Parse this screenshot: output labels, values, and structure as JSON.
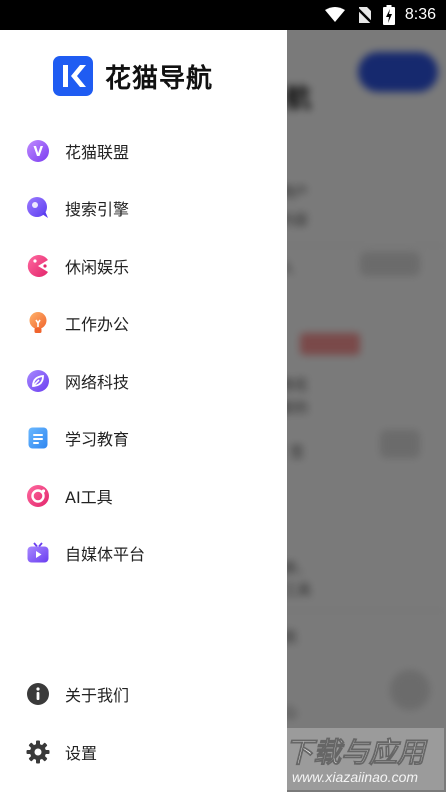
{
  "status_bar": {
    "time": "8:36"
  },
  "app": {
    "name": "花猫导航"
  },
  "menu": [
    {
      "label": "花猫联盟",
      "icon": "v-badge-icon"
    },
    {
      "label": "搜索引擎",
      "icon": "search-bubble-icon"
    },
    {
      "label": "休闲娱乐",
      "icon": "pacman-icon"
    },
    {
      "label": "工作办公",
      "icon": "lightbulb-icon"
    },
    {
      "label": "网络科技",
      "icon": "leaf-icon"
    },
    {
      "label": "学习教育",
      "icon": "document-icon"
    },
    {
      "label": "AI工具",
      "icon": "ring-icon"
    },
    {
      "label": "自媒体平台",
      "icon": "tv-icon"
    }
  ],
  "footer_menu": [
    {
      "label": "关于我们",
      "icon": "info-icon"
    },
    {
      "label": "设置",
      "icon": "gear-icon"
    }
  ],
  "watermark": {
    "title": "下载与应用",
    "url": "www.xiazaiinao.com"
  },
  "colors": {
    "brand": "#1f5cf2",
    "overlay": "rgba(0,0,0,0.52)"
  }
}
